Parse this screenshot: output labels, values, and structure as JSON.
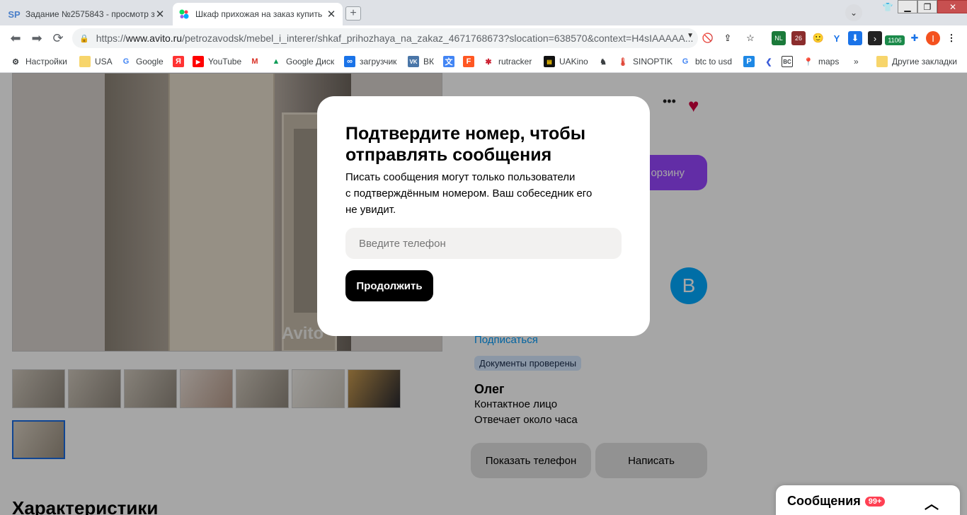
{
  "browser": {
    "tabs": [
      {
        "title": "Задание №2575843 - просмотр з",
        "favicon": "SP",
        "active": false
      },
      {
        "title": "Шкаф прихожая на заказ купить",
        "favicon": "avito-icon",
        "active": true
      }
    ],
    "new_tab_symbol": "+",
    "url": {
      "scheme": "https://",
      "host": "www.avito.ru",
      "path": "/petrozavodsk/mebel_i_interer/shkaf_prihozhaya_na_zakaz_4671768673?slocation=638570&context=H4sIAAAAA..."
    },
    "extension_badges": {
      "nl": "NL",
      "count26": "26",
      "counter": "1106",
      "profile": "I"
    },
    "bookmarks": [
      {
        "label": "Настройки",
        "icon": "gear-icon"
      },
      {
        "label": "USA",
        "icon": "folder-icon"
      },
      {
        "label": "Google",
        "icon": "G"
      },
      {
        "label": "",
        "icon": "Я"
      },
      {
        "label": "YouTube",
        "icon": "youtube-icon"
      },
      {
        "label": "",
        "icon": "M"
      },
      {
        "label": "Google Диск",
        "icon": "drive-icon"
      },
      {
        "label": "загрузчик",
        "icon": "∞"
      },
      {
        "label": "ВК",
        "icon": "vk-icon"
      },
      {
        "label": "",
        "icon": "translate-icon"
      },
      {
        "label": "",
        "icon": "F"
      },
      {
        "label": "rutracker",
        "icon": "rutracker-icon"
      },
      {
        "label": "UAKino",
        "icon": "film-icon"
      },
      {
        "label": "",
        "icon": "chess-icon"
      },
      {
        "label": "SINOPTIK",
        "icon": "thermometer-icon"
      },
      {
        "label": "btc to usd",
        "icon": "G"
      },
      {
        "label": "",
        "icon": "P"
      },
      {
        "label": "",
        "icon": "arrow-icon"
      },
      {
        "label": "",
        "icon": "BC"
      },
      {
        "label": "maps",
        "icon": "pin-icon"
      }
    ],
    "more_bookmarks": "»",
    "other_bookmarks": "Другие закладки"
  },
  "page": {
    "watermark": "Avito",
    "cart_button": "орзину",
    "avatar_letter": "В",
    "subscribe": "Подписаться",
    "docs_badge": "Документы проверены",
    "seller_name": "Олег",
    "seller_role": "Контактное лицо",
    "seller_response": "Отвечает около часа",
    "show_phone": "Показать телефон",
    "write": "Написать",
    "characteristics_heading": "Характеристики",
    "messages_label": "Сообщения",
    "messages_badge": "99+"
  },
  "modal": {
    "close": "×",
    "title": "Подтвердите номер, чтобы отправлять сообщения",
    "text_lines": [
      "Писать сообщения могут только пользователи",
      "с подтверждённым номером. Ваш собеседник его",
      "не увидит."
    ],
    "phone_placeholder": "Введите телефон",
    "continue_button": "Продолжить"
  },
  "colors": {
    "accent_purple": "#9746ff",
    "heart": "#d3003f",
    "link": "#0099f7"
  }
}
